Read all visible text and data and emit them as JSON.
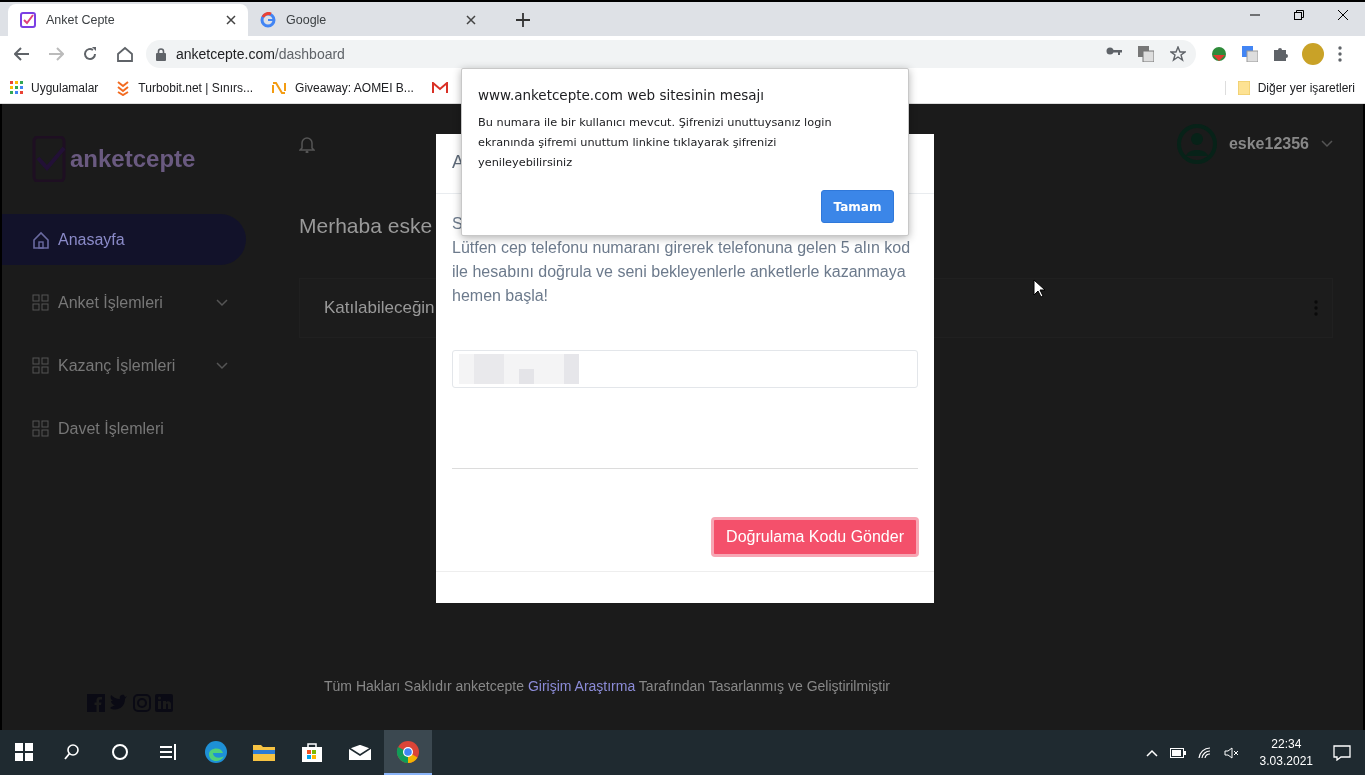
{
  "browser": {
    "tabs": [
      {
        "title": "Anket Cepte",
        "kind": "anketcepte",
        "selected": true
      },
      {
        "title": "Google",
        "kind": "google",
        "selected": false
      }
    ],
    "address": {
      "host": "anketcepte.com",
      "path": "/dashboard"
    },
    "bookmarks": [
      {
        "label": "Uygulamalar",
        "kind": "apps"
      },
      {
        "label": "Turbobit.net | Sınırs...",
        "kind": "turbobit"
      },
      {
        "label": "Giveaway: AOMEI B...",
        "kind": "giveaway"
      },
      {
        "kind": "gmail"
      }
    ],
    "other_bookmarks": "Diğer yer işaretleri"
  },
  "page": {
    "logo": "anketcepte",
    "user": "eske12356",
    "nav": [
      {
        "label": "Anasayfa",
        "kind": "home",
        "selected": true,
        "expandable": false
      },
      {
        "label": "Anket İşlemleri",
        "kind": "grid",
        "selected": false,
        "expandable": true
      },
      {
        "label": "Kazanç İşlemleri",
        "kind": "grid",
        "selected": false,
        "expandable": true
      },
      {
        "label": "Davet İşlemleri",
        "kind": "grid",
        "selected": false,
        "expandable": false
      }
    ],
    "greeting": "Merhaba eske",
    "card_title": "Katılabileceğin",
    "socials": [
      {
        "kind": "facebook"
      },
      {
        "kind": "twitter"
      },
      {
        "kind": "instagram"
      },
      {
        "kind": "linkedin"
      }
    ],
    "footer": {
      "prefix": "Tüm Hakları Saklıdır anketcepte",
      "link": "Girişim Araştırma",
      "suffix": "Tarafından Tasarlanmış ve Geliştirilmiştir"
    }
  },
  "modal": {
    "title": "A",
    "first_line": "S",
    "text": "Lütfen cep telefonu numaranı girerek telefonuna gelen 5 alın kod ile hesabını doğrula ve seni bekleyenlerle anketlerle kazanmaya hemen başla!",
    "button": "Doğrulama Kodu Gönder"
  },
  "alert": {
    "title": "www.anketcepte.com web sitesinin mesajı",
    "message": "Bu numara ile bir kullanıcı mevcut. Şifrenizi unuttuysanız login ekranında şifremi unuttum linkine tıklayarak şifrenizi yenileyebilirsiniz",
    "button": "Tamam"
  },
  "taskbar": {
    "apps": [
      {
        "kind": "search",
        "selected": false
      },
      {
        "kind": "cortana",
        "selected": false
      },
      {
        "kind": "taskview",
        "selected": false
      },
      {
        "kind": "edge",
        "selected": false
      },
      {
        "kind": "explorer",
        "selected": false
      },
      {
        "kind": "store",
        "selected": false
      },
      {
        "kind": "mail",
        "selected": false
      },
      {
        "kind": "chrome",
        "selected": true
      }
    ],
    "time": "22:34",
    "date": "3.03.2021"
  }
}
